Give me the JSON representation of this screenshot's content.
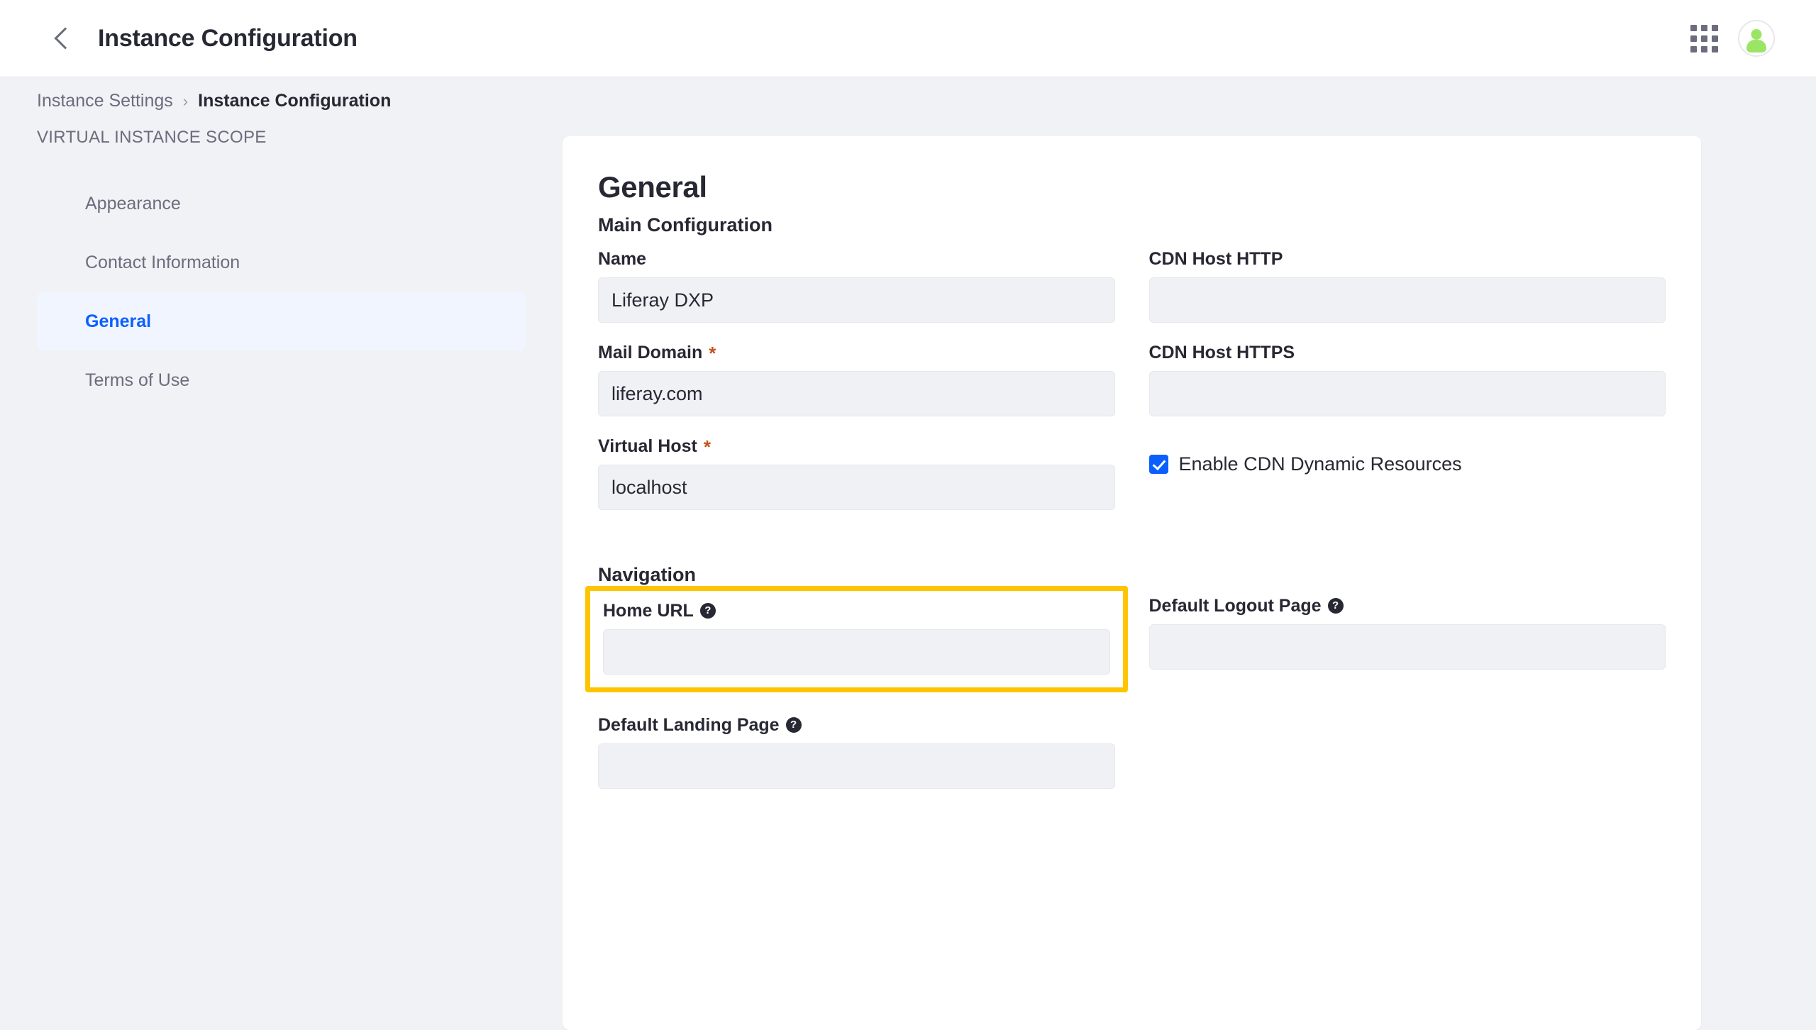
{
  "topbar": {
    "back_icon": "chevron-left-icon",
    "title": "Instance Configuration",
    "grid_icon": "applications-grid-icon",
    "avatar_icon": "user-avatar-icon"
  },
  "breadcrumb": {
    "parent": "Instance Settings",
    "separator": "›",
    "current": "Instance Configuration"
  },
  "sidebar": {
    "heading": "VIRTUAL INSTANCE SCOPE",
    "items": [
      {
        "label": "Appearance",
        "active": false
      },
      {
        "label": "Contact Information",
        "active": false
      },
      {
        "label": "General",
        "active": true
      },
      {
        "label": "Terms of Use",
        "active": false
      }
    ]
  },
  "main": {
    "page_title": "General",
    "sections": {
      "main_configuration": {
        "title": "Main Configuration",
        "fields": {
          "name": {
            "label": "Name",
            "value": "Liferay DXP",
            "required": false
          },
          "mail_domain": {
            "label": "Mail Domain",
            "value": "liferay.com",
            "required": true,
            "required_mark": "*"
          },
          "virtual_host": {
            "label": "Virtual Host",
            "value": "localhost",
            "required": true,
            "required_mark": "*"
          },
          "cdn_host_http": {
            "label": "CDN Host HTTP",
            "value": "",
            "required": false
          },
          "cdn_host_https": {
            "label": "CDN Host HTTPS",
            "value": "",
            "required": false
          },
          "enable_cdn_dynamic_resources": {
            "label": "Enable CDN Dynamic Resources",
            "checked": true
          }
        }
      },
      "navigation": {
        "title": "Navigation",
        "fields": {
          "home_url": {
            "label": "Home URL",
            "value": "",
            "help": "?",
            "highlighted": true
          },
          "default_logout_page": {
            "label": "Default Logout Page",
            "value": "",
            "help": "?"
          },
          "default_landing_page": {
            "label": "Default Landing Page",
            "value": "",
            "help": "?"
          }
        }
      }
    }
  },
  "colors": {
    "accent_blue": "#0B5FFF",
    "highlight_yellow": "#FDC500",
    "required_orange": "#C1531B",
    "page_bg": "#F1F2F5",
    "input_bg": "#F0F1F5",
    "avatar_green": "#9BE564"
  }
}
